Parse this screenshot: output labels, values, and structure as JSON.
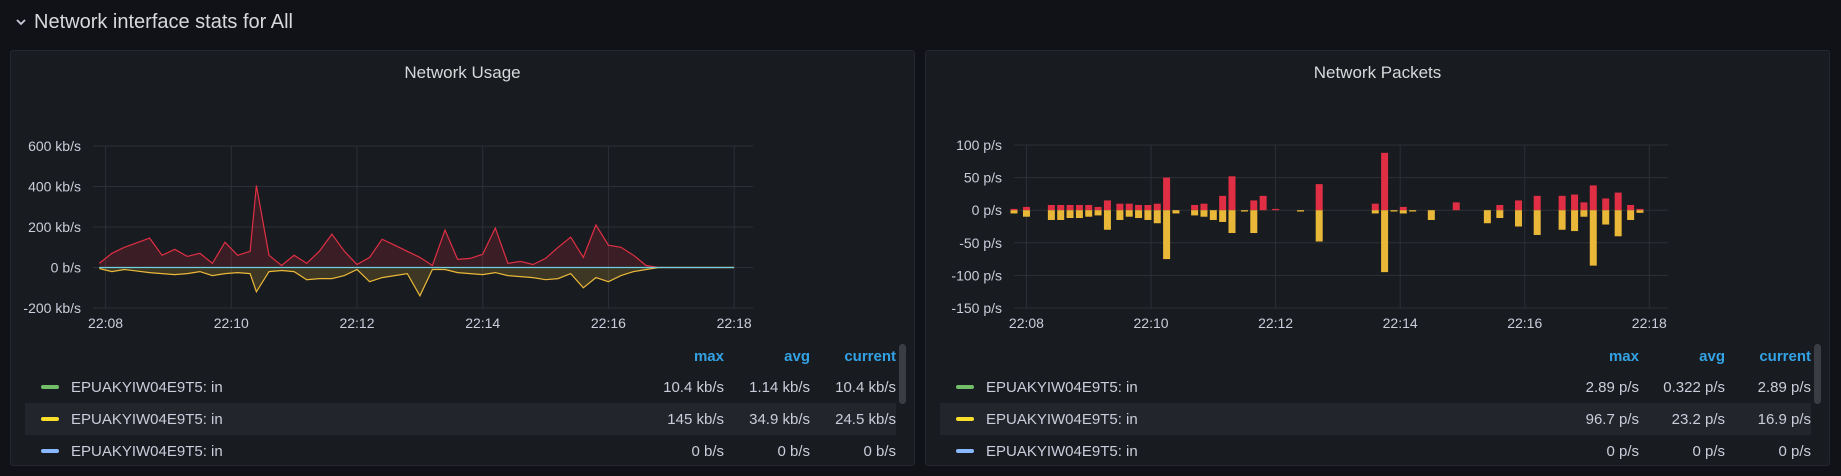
{
  "row": {
    "title": "Network interface stats for All"
  },
  "panels": [
    {
      "title": "Network Usage",
      "legend": {
        "headers": [
          "max",
          "avg",
          "current"
        ],
        "rows": [
          {
            "name": "EPUAKYIW04E9T5: in",
            "color": "#73bf69",
            "max": "10.4 kb/s",
            "avg": "1.14 kb/s",
            "current": "10.4 kb/s"
          },
          {
            "name": "EPUAKYIW04E9T5: in",
            "color": "#fade2a",
            "max": "145 kb/s",
            "avg": "34.9 kb/s",
            "current": "24.5 kb/s"
          },
          {
            "name": "EPUAKYIW04E9T5: in",
            "color": "#8ab8ff",
            "max": "0 b/s",
            "avg": "0 b/s",
            "current": "0 b/s"
          }
        ]
      }
    },
    {
      "title": "Network Packets",
      "legend": {
        "headers": [
          "max",
          "avg",
          "current"
        ],
        "rows": [
          {
            "name": "EPUAKYIW04E9T5: in",
            "color": "#73bf69",
            "max": "2.89 p/s",
            "avg": "0.322 p/s",
            "current": "2.89 p/s"
          },
          {
            "name": "EPUAKYIW04E9T5: in",
            "color": "#fade2a",
            "max": "96.7 p/s",
            "avg": "23.2 p/s",
            "current": "16.9 p/s"
          },
          {
            "name": "EPUAKYIW04E9T5: in",
            "color": "#8ab8ff",
            "max": "0 p/s",
            "avg": "0 p/s",
            "current": "0 p/s"
          }
        ]
      }
    }
  ],
  "chart_data": [
    {
      "type": "area",
      "title": "Network Usage",
      "x_ticks": [
        "22:08",
        "22:10",
        "22:12",
        "22:14",
        "22:16",
        "22:18"
      ],
      "y_ticks": [
        "600 kb/s",
        "400 kb/s",
        "200 kb/s",
        "0 b/s",
        "-200 kb/s"
      ],
      "ylim": [
        -200,
        600
      ],
      "x_minutes": [
        7.9,
        8.1,
        8.3,
        8.7,
        8.9,
        9.1,
        9.3,
        9.5,
        9.7,
        9.9,
        10.1,
        10.3,
        10.4,
        10.6,
        10.8,
        11.0,
        11.2,
        11.4,
        11.6,
        11.8,
        12.0,
        12.2,
        12.4,
        12.6,
        12.8,
        13.0,
        13.2,
        13.4,
        13.6,
        13.8,
        14.0,
        14.2,
        14.4,
        14.6,
        14.8,
        15.0,
        15.2,
        15.4,
        15.6,
        15.8,
        16.0,
        16.2,
        16.4,
        16.6,
        16.8,
        17.0,
        17.2,
        17.4,
        17.6,
        17.8,
        18.0
      ],
      "series": [
        {
          "color": "#e02f44",
          "values": [
            20,
            70,
            100,
            145,
            60,
            90,
            55,
            70,
            20,
            125,
            60,
            80,
            405,
            60,
            10,
            60,
            20,
            80,
            165,
            80,
            15,
            50,
            140,
            110,
            80,
            50,
            10,
            185,
            40,
            45,
            65,
            195,
            20,
            30,
            15,
            45,
            100,
            150,
            50,
            210,
            110,
            100,
            60,
            10,
            0,
            0,
            0,
            0,
            0,
            0,
            0
          ]
        },
        {
          "color": "#eab839",
          "values": [
            -5,
            -20,
            -10,
            -25,
            -30,
            -35,
            -30,
            -20,
            -40,
            -30,
            -25,
            -30,
            -120,
            -20,
            -15,
            -20,
            -60,
            -55,
            -55,
            -40,
            -10,
            -70,
            -50,
            -40,
            -30,
            -140,
            -10,
            -10,
            -25,
            -30,
            -35,
            -25,
            -40,
            -45,
            -50,
            -60,
            -55,
            -30,
            -100,
            -50,
            -70,
            -40,
            -20,
            -10,
            0,
            0,
            0,
            0,
            0,
            0,
            0
          ]
        },
        {
          "color": "#6ed0e0",
          "values": [
            0,
            0,
            0,
            0,
            0,
            0,
            0,
            0,
            0,
            0,
            0,
            0,
            0,
            0,
            0,
            0,
            0,
            0,
            0,
            0,
            0,
            0,
            0,
            0,
            0,
            0,
            0,
            0,
            0,
            0,
            0,
            0,
            0,
            0,
            0,
            0,
            0,
            0,
            0,
            0,
            0,
            0,
            0,
            0,
            0,
            0,
            0,
            0,
            0,
            0,
            0
          ]
        }
      ]
    },
    {
      "type": "bar",
      "title": "Network Packets",
      "x_ticks": [
        "22:08",
        "22:10",
        "22:12",
        "22:14",
        "22:16",
        "22:18"
      ],
      "y_ticks": [
        "100 p/s",
        "50 p/s",
        "0 p/s",
        "-50 p/s",
        "-100 p/s",
        "-150 p/s"
      ],
      "ylim": [
        -150,
        100
      ],
      "x_minutes": [
        7.8,
        8.0,
        8.4,
        8.55,
        8.7,
        8.85,
        9.0,
        9.15,
        9.3,
        9.5,
        9.65,
        9.8,
        9.95,
        10.1,
        10.25,
        10.4,
        10.7,
        10.85,
        11.0,
        11.15,
        11.3,
        11.5,
        11.65,
        11.8,
        12.0,
        12.4,
        12.7,
        13.6,
        13.75,
        13.9,
        14.05,
        14.2,
        14.5,
        14.9,
        15.4,
        15.6,
        15.9,
        16.0,
        16.2,
        16.6,
        16.8,
        16.95,
        17.1,
        17.3,
        17.5,
        17.7,
        17.85,
        18.0,
        18.15
      ],
      "series": [
        {
          "name": "",
          "color": "#e02f44",
          "values": [
            2,
            5,
            8,
            8,
            8,
            8,
            8,
            5,
            15,
            10,
            10,
            8,
            8,
            10,
            50,
            0,
            8,
            10,
            0,
            22,
            52,
            0,
            15,
            22,
            2,
            0,
            40,
            10,
            88,
            0,
            5,
            0,
            0,
            12,
            0,
            8,
            15,
            0,
            22,
            22,
            24,
            12,
            38,
            18,
            27,
            8,
            2,
            0,
            0
          ]
        },
        {
          "name": "",
          "color": "#eab839",
          "values": [
            -5,
            -10,
            -15,
            -15,
            -12,
            -12,
            -10,
            -8,
            -30,
            -15,
            -10,
            -12,
            -15,
            -20,
            -75,
            -5,
            -8,
            -10,
            -15,
            -18,
            -35,
            -2,
            -35,
            0,
            0,
            -2,
            -48,
            -5,
            -95,
            -2,
            -5,
            -2,
            -15,
            0,
            -20,
            -12,
            -25,
            0,
            -38,
            -30,
            -32,
            -10,
            -85,
            -22,
            -40,
            -15,
            -4,
            0,
            0
          ]
        }
      ]
    }
  ]
}
